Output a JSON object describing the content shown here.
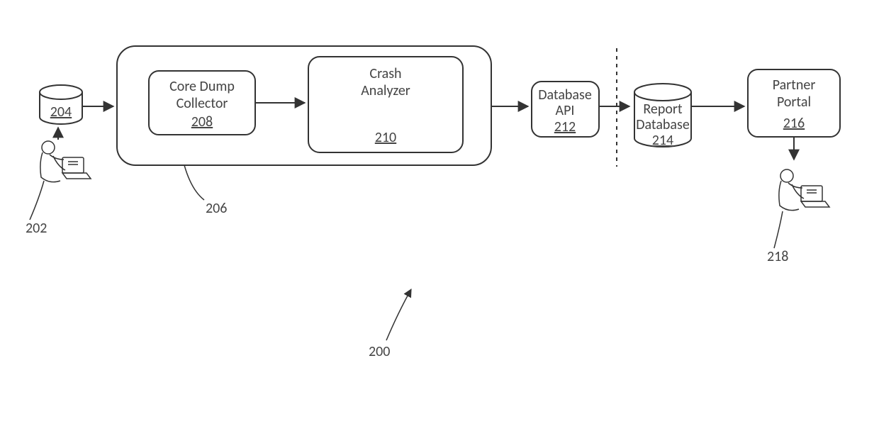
{
  "refs": {
    "diagram": "200",
    "user_left": "202",
    "db_left": "204",
    "container": "206",
    "core_dump_collector": "208",
    "crash_analyzer": "210",
    "database_api": "212",
    "report_database": "214",
    "partner_portal": "216",
    "user_right": "218"
  },
  "labels": {
    "core_dump_collector_l1": "Core Dump",
    "core_dump_collector_l2": "Collector",
    "crash_analyzer_l1": "Crash",
    "crash_analyzer_l2": "Analyzer",
    "database_api_l1": "Database",
    "database_api_l2": "API",
    "report_database_l1": "Report",
    "report_database_l2": "Database",
    "partner_portal_l1": "Partner",
    "partner_portal_l2": "Portal"
  }
}
